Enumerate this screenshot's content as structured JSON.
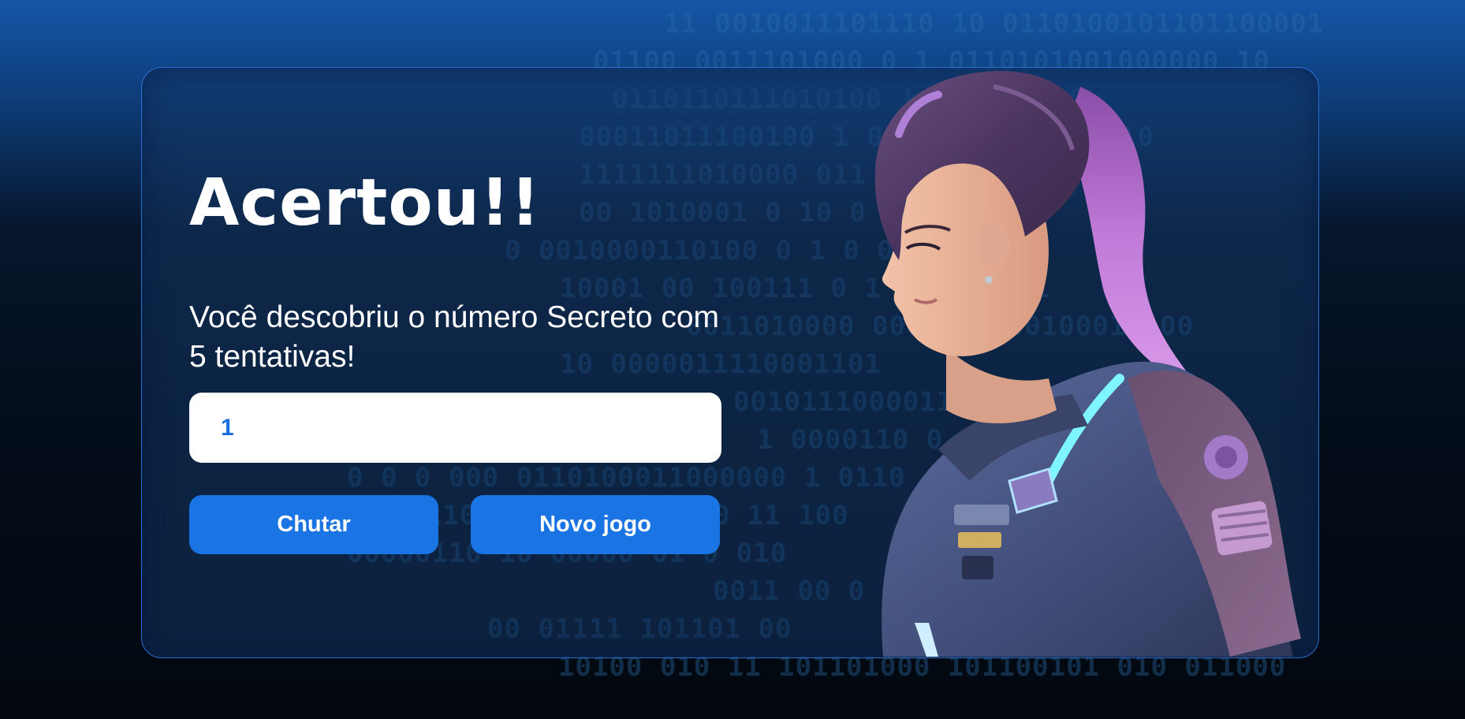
{
  "game": {
    "title": "Acertou!!",
    "message": "Você descobriu o número Secreto com 5 tentativas!",
    "guess_input_value": "1",
    "guess_button_label": "Chutar",
    "new_game_button_label": "Novo jogo"
  },
  "background_binary": [
    "11 0010011101110 10 0110100101101100001",
    "01100 0011101000 0 1 0110101001000000 10",
    "0110110111010100 1 11011 1 0",
    "00011011100100 1 011 1011010000010",
    "1111111010000 011 0000011 0 0",
    "00 1010001 0 10 0 001011",
    "0 0010000110100 0 1 0 0",
    "10001 00 100111 0 1 1 1 01001",
    "0011010000 000 0 0 00100011 00",
    "10 0000011110001101",
    "0010111000011 0001 01000",
    "1 0000110 0 00110",
    "0 0 0 000 0110100011000000 1 0110",
    "11010 0101110100 0 11 100",
    "00000110 10 00000 01 0 010",
    "0011 00 0",
    "00 01111 101101 00",
    "10100 010 11 101101000 101100101 010 011000"
  ],
  "colors": {
    "accent": "#1b74e4",
    "card_border": "#2a6fd0",
    "input_text": "#1a6ee0",
    "title_text": "#ffffff"
  },
  "icons": {
    "character": "astronaut-girl-illustration"
  }
}
